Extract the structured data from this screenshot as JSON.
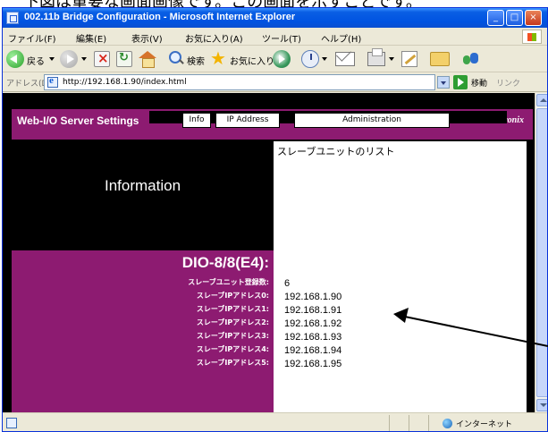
{
  "caption": "下図は重要な画面画像です。この画面を示すことです。",
  "window": {
    "title": "002.11b Bridge Configuration - Microsoft Internet Explorer"
  },
  "menu": [
    "ファイル(F)",
    "編集(E)",
    "表示(V)",
    "お気に入り(A)",
    "ツール(T)",
    "ヘルプ(H)"
  ],
  "toolbar": {
    "back_label": "戻る",
    "search_label": "検索",
    "favorites_label": "お気に入り"
  },
  "address": {
    "label": "アドレス(D)",
    "value": "http://192.168.1.90/index.html",
    "go_label": "移動",
    "links_label": "リンク"
  },
  "page": {
    "title": "Web-I/O Server Settings",
    "brand": "Lantronix",
    "tabs": [
      "Info",
      "IP Address",
      "Administration"
    ],
    "information_heading": "Information",
    "slave_list_title": "スレーブユニットのリスト",
    "device_name": "DIO-8/8(E4):",
    "labels": [
      "スレーブユニット登録数:",
      "スレーブIPアドレス0:",
      "スレーブIPアドレス1:",
      "スレーブIPアドレス2:",
      "スレーブIPアドレス3:",
      "スレーブIPアドレス4:",
      "スレーブIPアドレス5:"
    ],
    "values": [
      "6",
      "192.168.1.90",
      "192.168.1.91",
      "192.168.1.92",
      "192.168.1.93",
      "192.168.1.94",
      "192.168.1.95"
    ]
  },
  "status": {
    "zone": "インターネット"
  },
  "colors": {
    "accent": "#8d1b71",
    "titlebar": "#0053e1"
  }
}
